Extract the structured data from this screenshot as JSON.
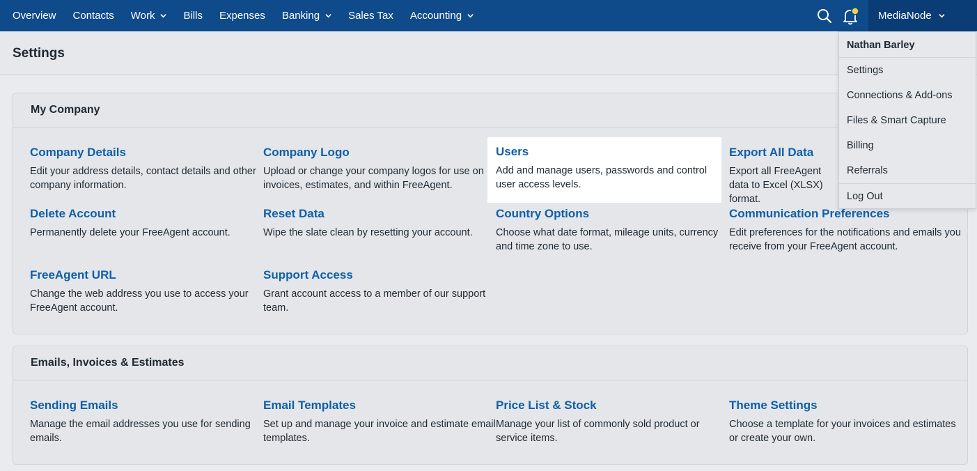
{
  "nav": {
    "items": [
      {
        "label": "Overview",
        "has_menu": false
      },
      {
        "label": "Contacts",
        "has_menu": false
      },
      {
        "label": "Work",
        "has_menu": true
      },
      {
        "label": "Bills",
        "has_menu": false
      },
      {
        "label": "Expenses",
        "has_menu": false
      },
      {
        "label": "Banking",
        "has_menu": true
      },
      {
        "label": "Sales Tax",
        "has_menu": false
      },
      {
        "label": "Accounting",
        "has_menu": true
      }
    ],
    "account_label": "MediaNode",
    "colors": {
      "nav_bg": "#0f4a8a",
      "account_bg": "#0a3d75",
      "notification_dot": "#e8d44d"
    }
  },
  "page": {
    "title": "Settings"
  },
  "my_company": {
    "heading": "My Company",
    "cards": [
      {
        "title": "Company Details",
        "desc": "Edit your address details, contact details and other company information."
      },
      {
        "title": "Company Logo",
        "desc": "Upload or change your company logos for use on invoices, estimates, and within FreeAgent."
      },
      {
        "title": "Users",
        "desc": "Add and manage users, passwords and control user access levels."
      },
      {
        "title": "Export All Data",
        "desc": "Export all FreeAgent data to Excel (XLSX) format."
      },
      {
        "title": "Delete Account",
        "desc": "Permanently delete your FreeAgent account."
      },
      {
        "title": "Reset Data",
        "desc": "Wipe the slate clean by resetting your account."
      },
      {
        "title": "Country Options",
        "desc": "Choose what date format, mileage units, currency and time zone to use."
      },
      {
        "title": "Communication Preferences",
        "desc": "Edit preferences for the notifications and emails you receive from your FreeAgent account."
      },
      {
        "title": "FreeAgent URL",
        "desc": "Change the web address you use to access your FreeAgent account."
      },
      {
        "title": "Support Access",
        "desc": "Grant account access to a member of our support team."
      }
    ]
  },
  "emails": {
    "heading": "Emails, Invoices & Estimates",
    "cards": [
      {
        "title": "Sending Emails",
        "desc": "Manage the email addresses you use for sending emails."
      },
      {
        "title": "Email Templates",
        "desc": "Set up and manage your invoice and estimate email templates."
      },
      {
        "title": "Price List & Stock",
        "desc": "Manage your list of commonly sold product or service items."
      },
      {
        "title": "Theme Settings",
        "desc": "Choose a template for your invoices and estimates or create your own."
      }
    ]
  },
  "account_menu": {
    "user_name": "Nathan Barley",
    "items": [
      "Settings",
      "Connections & Add-ons",
      "Files & Smart Capture",
      "Billing",
      "Referrals"
    ],
    "logout": "Log Out"
  }
}
